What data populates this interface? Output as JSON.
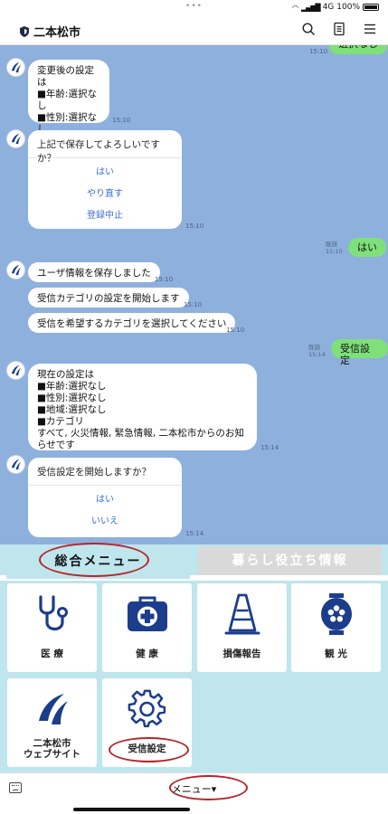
{
  "status_bar": {
    "dots": "•••",
    "network": "4G",
    "battery": "100%"
  },
  "header": {
    "title": "二本松市"
  },
  "chat": {
    "partial_reply": {
      "text": "選択なし",
      "time": "15:10"
    },
    "msg1": {
      "text": "変更後の設定は\n■年齢:選択なし\n■性別:選択なし\n■地域:選択なし\nです",
      "time": "15:10"
    },
    "q1": {
      "title": "上記で保存してよろしいですか？",
      "options": [
        "はい",
        "やり直す",
        "登録中止"
      ],
      "time": "15:10"
    },
    "reply1": {
      "read": "既読",
      "time": "15:10",
      "text": "はい"
    },
    "msg2": {
      "text": "ユーザ情報を保存しました",
      "time": "15:10"
    },
    "msg3": {
      "text": "受信カテゴリの設定を開始します",
      "time": "15:10"
    },
    "msg4": {
      "text": "受信を希望するカテゴリを選択してください",
      "time": "15:10"
    },
    "reply2": {
      "read": "既読",
      "time": "15:14",
      "text": "受信設定"
    },
    "msg5": {
      "text": "現在の設定は\n■年齢:選択なし\n■性別:選択なし\n■地域:選択なし\n■カテゴリ\nすべて, 火災情報, 緊急情報, 二本松市からのお知らせです",
      "time": "15:14"
    },
    "q2": {
      "title": "受信設定を開始しますか？",
      "options": [
        "はい",
        "いいえ"
      ],
      "time": "15:14"
    }
  },
  "menu": {
    "tabs": {
      "general": "総合メニュー",
      "living": "暮らし役立ち情報"
    },
    "tiles": {
      "medical": "医 療",
      "health": "健 康",
      "damage": "損傷報告",
      "tourism": "観 光",
      "website": "二本松市\nウェブサイト",
      "settings": "受信設定"
    }
  },
  "bottom_bar": {
    "menu_label": "メニュー▾"
  },
  "colors": {
    "chat_bg": "#8eb0dd",
    "menu_bg": "#bfe5ed",
    "reply_bubble": "#7fe07a",
    "accent_blue": "#1c3d8c",
    "annotation_red": "#b3262a"
  }
}
